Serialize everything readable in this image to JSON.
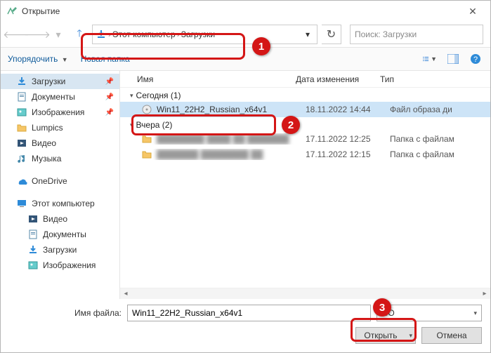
{
  "title": "Открытие",
  "breadcrumb": {
    "root": "Этот компьютер",
    "folder": "Загрузки"
  },
  "search": {
    "placeholder": "Поиск: Загрузки"
  },
  "toolbar": {
    "organize": "Упорядочить",
    "newfolder": "Новая папка"
  },
  "columns": {
    "name": "Имя",
    "date": "Дата изменения",
    "type": "Тип"
  },
  "sidebar": {
    "quick": [
      {
        "label": "Загрузки",
        "icon": "download",
        "pin": true,
        "sel": true
      },
      {
        "label": "Документы",
        "icon": "doc",
        "pin": true
      },
      {
        "label": "Изображения",
        "icon": "img",
        "pin": true
      },
      {
        "label": "Lumpics",
        "icon": "folder"
      },
      {
        "label": "Видео",
        "icon": "video"
      },
      {
        "label": "Музыка",
        "icon": "music"
      }
    ],
    "onedrive": "OneDrive",
    "thispc": "Этот компьютер",
    "pcitems": [
      {
        "label": "Видео",
        "icon": "video"
      },
      {
        "label": "Документы",
        "icon": "doc"
      },
      {
        "label": "Загрузки",
        "icon": "download"
      },
      {
        "label": "Изображения",
        "icon": "img"
      }
    ]
  },
  "groups": [
    {
      "title": "Сегодня (1)",
      "rows": [
        {
          "name": "Win11_22H2_Russian_x64v1",
          "date": "18.11.2022 14:44",
          "type": "Файл образа ди",
          "icon": "iso",
          "sel": true
        }
      ]
    },
    {
      "title": "Вчера (2)",
      "rows": [
        {
          "name": "████████ ████ ██ ███████",
          "date": "17.11.2022 12:25",
          "type": "Папка с файлам",
          "icon": "folder",
          "blur": true
        },
        {
          "name": "███████ ████████ ██",
          "date": "17.11.2022 12:15",
          "type": "Папка с файлам",
          "icon": "folder",
          "blur": true
        }
      ]
    }
  ],
  "filename": {
    "label": "Имя файла:",
    "value": "Win11_22H2_Russian_x64v1"
  },
  "filter": "ISO",
  "buttons": {
    "open": "Открыть",
    "cancel": "Отмена"
  },
  "annotations": {
    "n1": "1",
    "n2": "2",
    "n3": "3"
  }
}
